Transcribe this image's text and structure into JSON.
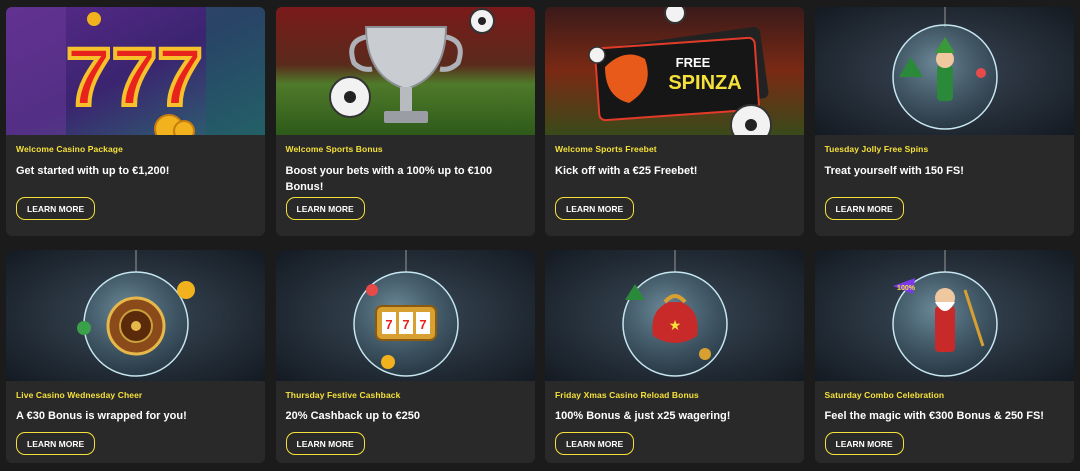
{
  "colors": {
    "accent": "#f6e13b",
    "card_bg": "#292929",
    "page_bg": "#1b1b1b"
  },
  "promotions": [
    {
      "label": "Welcome Casino Package",
      "text": "Get started with up to €1,200!",
      "button": "LEARN MORE",
      "image": "slot-777-banner"
    },
    {
      "label": "Welcome Sports Bonus",
      "text": "Boost your bets with a 100% up to €100 Bonus!",
      "button": "LEARN MORE",
      "image": "trophy-footballs-banner"
    },
    {
      "label": "Welcome Sports Freebet",
      "text": "Kick off with a €25 Freebet!",
      "button": "LEARN MORE",
      "image": "free-spinza-ticket-banner",
      "image_text": {
        "line1": "FREE",
        "line2": "SPINZA"
      }
    },
    {
      "label": "Tuesday Jolly Free Spins",
      "text": "Treat yourself with 150 FS!",
      "button": "LEARN MORE",
      "image": "elf-ornament-banner"
    },
    {
      "label": "Live Casino Wednesday Cheer",
      "text": "A €30 Bonus is wrapped for you!",
      "button": "LEARN MORE",
      "image": "roulette-ornament-banner"
    },
    {
      "label": "Thursday Festive Cashback",
      "text": "20% Cashback up to €250",
      "button": "LEARN MORE",
      "image": "slot-machine-ornament-banner"
    },
    {
      "label": "Friday Xmas Casino Reload Bonus",
      "text": "100% Bonus & just x25 wagering!",
      "button": "LEARN MORE",
      "image": "gift-sack-ornament-banner"
    },
    {
      "label": "Saturday Combo Celebration",
      "text": "Feel the magic with €300 Bonus & 250 FS!",
      "button": "LEARN MORE",
      "image": "santa-warrior-ornament-banner",
      "image_text": {
        "badge": "100%"
      }
    }
  ]
}
